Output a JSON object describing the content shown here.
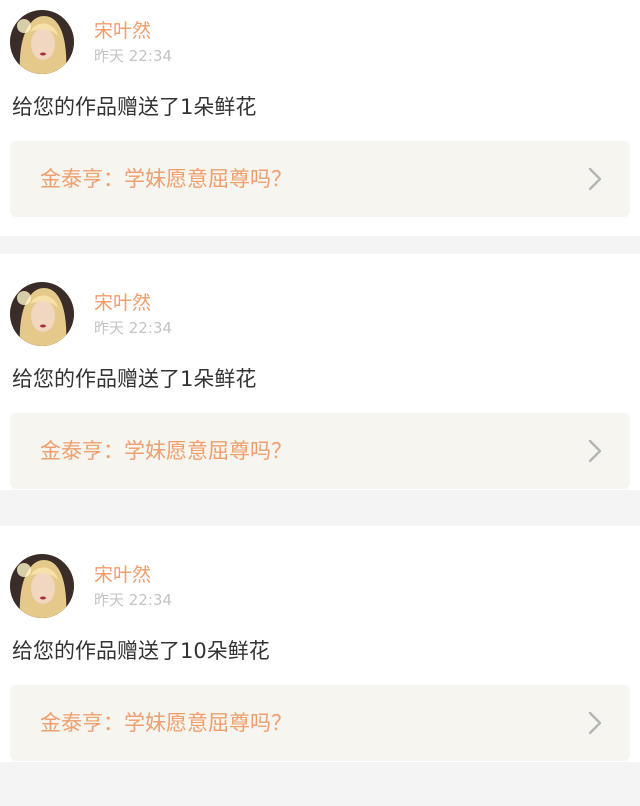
{
  "notifications": [
    {
      "username": "宋叶然",
      "time": "昨天 22:34",
      "message": "给您的作品赠送了1朵鲜花",
      "work_title": "金泰亨：学妹愿意屈尊吗？"
    },
    {
      "username": "宋叶然",
      "time": "昨天 22:34",
      "message": "给您的作品赠送了1朵鲜花",
      "work_title": "金泰亨：学妹愿意屈尊吗？"
    },
    {
      "username": "宋叶然",
      "time": "昨天 22:34",
      "message": "给您的作品赠送了10朵鲜花",
      "work_title": "金泰亨：学妹愿意屈尊吗？"
    }
  ],
  "colors": {
    "accent": "#ef9e6c",
    "time_gray": "#c4c4c4",
    "text": "#333333",
    "link_bg": "#f6f5f0",
    "page_bg": "#f4f4f4"
  },
  "icons": {
    "avatar": "user-avatar-photo",
    "chevron": "chevron-right-icon"
  }
}
